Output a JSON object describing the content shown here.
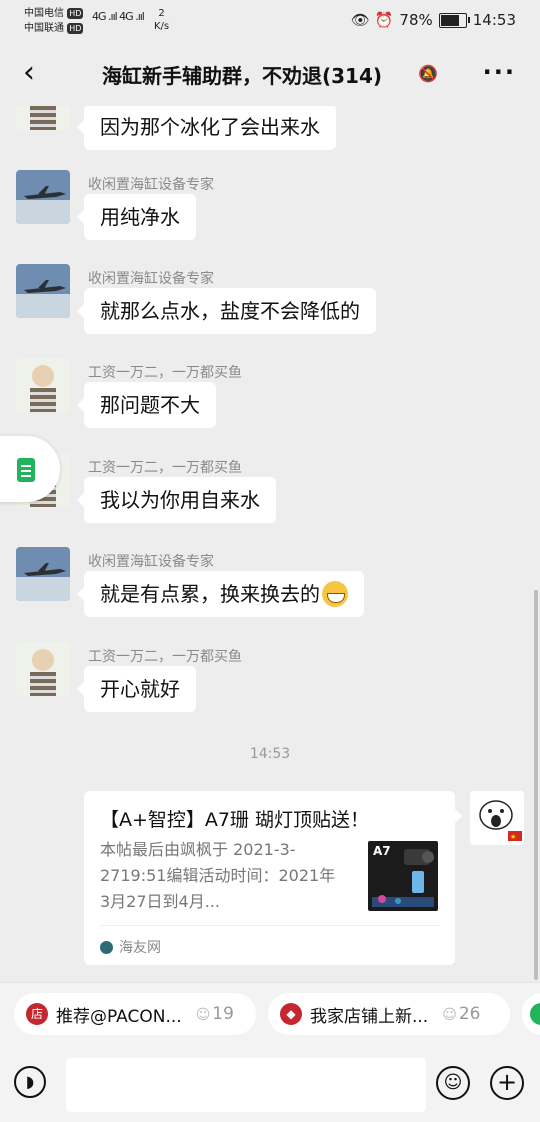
{
  "status_bar": {
    "carrier1": "中国电信",
    "carrier2": "中国联通",
    "hd": "HD",
    "signal": "4G .ııl 4G .ııl",
    "speed_value": "2",
    "speed_unit": "K/s",
    "icons": "👁 ⏰",
    "battery": "78%",
    "time": "14:53"
  },
  "header": {
    "back_icon": "‹",
    "title": "海缸新手辅助群，不劝退(314)",
    "mute_icon": "🔕",
    "more_icon": "···"
  },
  "messages": [
    {
      "sender": "",
      "text": "因为那个冰化了会出来水",
      "avatar": "sweater"
    },
    {
      "sender": "收闲置海缸设备专家",
      "text": "用纯净水",
      "avatar": "jet"
    },
    {
      "sender": "收闲置海缸设备专家",
      "text": "就那么点水，盐度不会降低的",
      "avatar": "jet"
    },
    {
      "sender": "工资一万二，一万都买鱼",
      "text": "那问题不大",
      "avatar": "sweater"
    },
    {
      "sender": "工资一万二，一万都买鱼",
      "text": "我以为你用自来水",
      "avatar": "sweater"
    },
    {
      "sender": "收闲置海缸设备专家",
      "text": "就是有点累，换来换去的",
      "avatar": "jet",
      "emoji": "grin"
    },
    {
      "sender": "工资一万二，一万都买鱼",
      "text": "开心就好",
      "avatar": "sweater"
    }
  ],
  "timestamp": "14:53",
  "link_card": {
    "title": "【A+智控】A7珊 瑚灯顶贴送！",
    "desc": "本帖最后由飒枫于 2021-3-2719:51编辑活动时间：2021年3月27日到4月...",
    "thumb_label": "A7",
    "source": "海友网"
  },
  "pills": [
    {
      "icon": "店",
      "label": "推荐@PACON...",
      "count": "19"
    },
    {
      "icon": "◆",
      "label": "我家店铺上新...",
      "count": "26"
    }
  ]
}
